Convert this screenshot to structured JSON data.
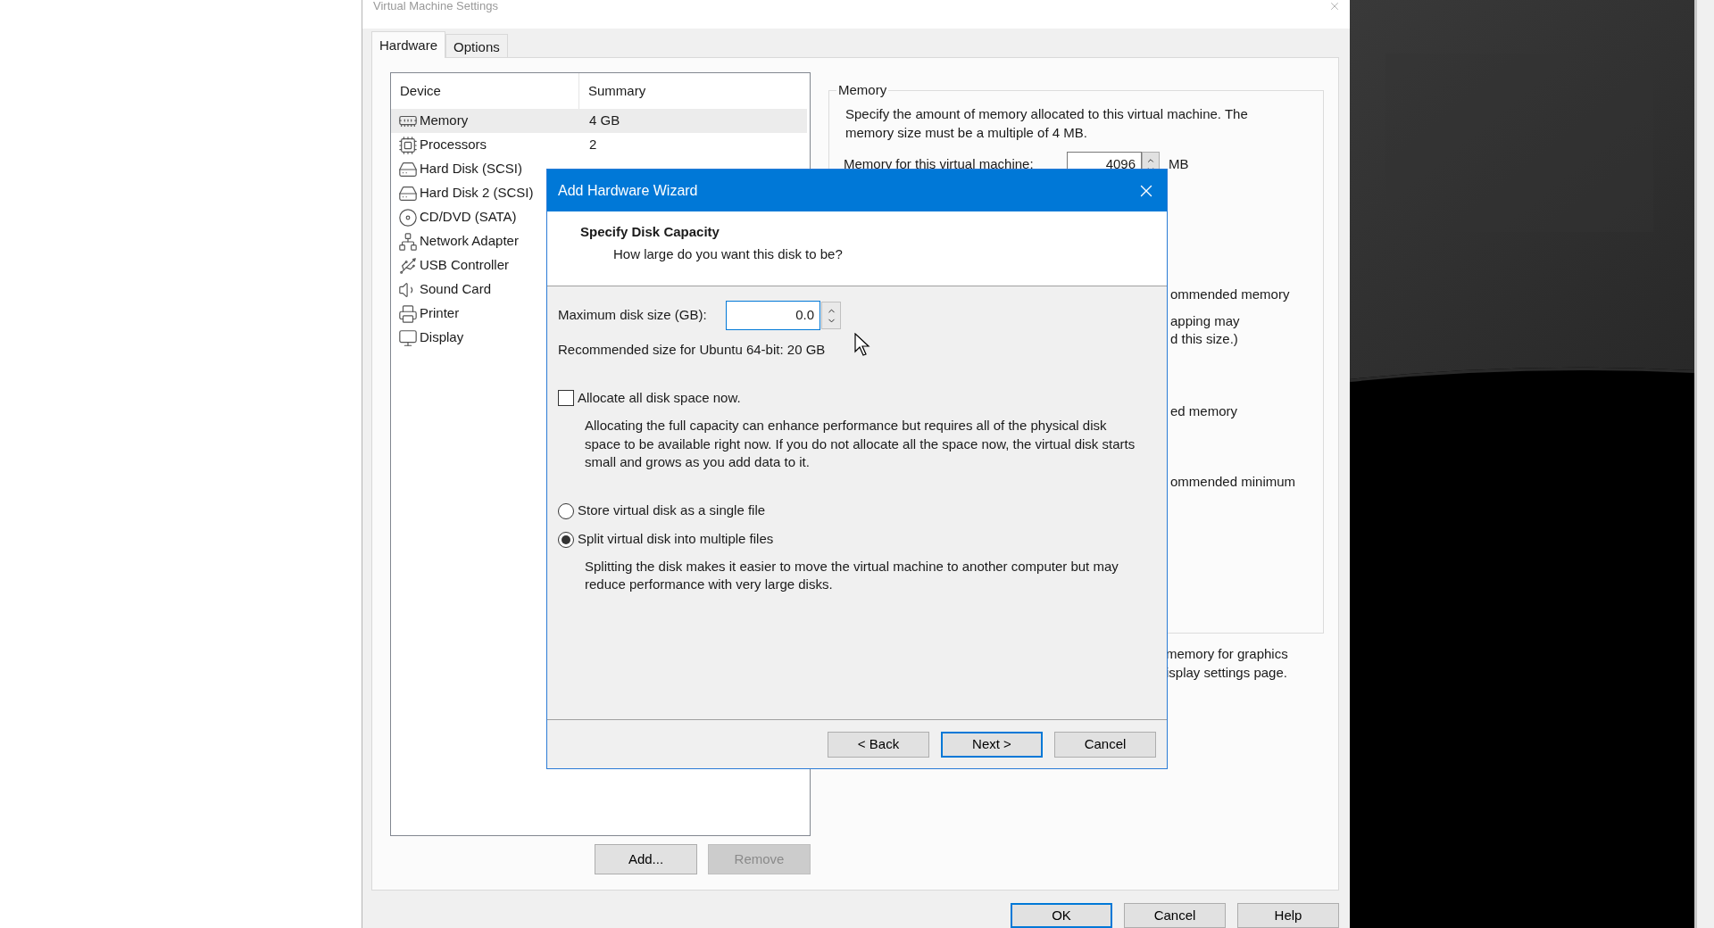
{
  "window": {
    "title": "Virtual Machine Settings"
  },
  "tabs": [
    {
      "label": "Hardware",
      "selected": true
    },
    {
      "label": "Options",
      "selected": false
    }
  ],
  "device_list": {
    "columns": [
      "Device",
      "Summary"
    ],
    "rows": [
      {
        "kind": "memory",
        "device": "Memory",
        "summary": "4 GB",
        "selected": true
      },
      {
        "kind": "processor",
        "device": "Processors",
        "summary": "2",
        "selected": false
      },
      {
        "kind": "disk",
        "device": "Hard Disk (SCSI)",
        "selected": false
      },
      {
        "kind": "disk",
        "device": "Hard Disk 2 (SCSI)",
        "selected": false
      },
      {
        "kind": "cd",
        "device": "CD/DVD (SATA)",
        "selected": false
      },
      {
        "kind": "network",
        "device": "Network Adapter",
        "selected": false
      },
      {
        "kind": "usb",
        "device": "USB Controller",
        "selected": false
      },
      {
        "kind": "sound",
        "device": "Sound Card",
        "selected": false
      },
      {
        "kind": "printer",
        "device": "Printer",
        "selected": false
      },
      {
        "kind": "display",
        "device": "Display",
        "selected": false
      }
    ]
  },
  "list_buttons": [
    {
      "label": "Add...",
      "disabled": false
    },
    {
      "label": "Remove",
      "disabled": true
    }
  ],
  "memory_panel": {
    "title": "Memory",
    "description": "Specify the amount of memory allocated to this virtual machine. The memory size must be a multiple of 4 MB.",
    "memory_label": "Memory for this virtual machine:",
    "memory_value": "4096",
    "unit": "MB",
    "group_fragments": [
      "ommended memory",
      "apping may",
      "d this size.)",
      "ed memory",
      "ommended minimum"
    ],
    "after_fragments": [
      "memory for graphics",
      "isplay settings page."
    ]
  },
  "footer_buttons": [
    {
      "label": "OK",
      "default": true
    },
    {
      "label": "Cancel",
      "default": false
    },
    {
      "label": "Help",
      "default": false
    }
  ],
  "wizard": {
    "title": "Add Hardware Wizard",
    "heading": "Specify Disk Capacity",
    "subheading": "How large do you want this disk to be?",
    "size_label": "Maximum disk size (GB):",
    "size_value": "0.0",
    "recommendation": "Recommended size for Ubuntu 64-bit: 20 GB",
    "allocate": {
      "label": "Allocate all disk space now.",
      "checked": false,
      "description": "Allocating the full capacity can enhance performance but requires all of the physical disk space to be available right now. If you do not allocate all the space now, the virtual disk starts small and grows as you add data to it."
    },
    "storage_options": [
      {
        "label": "Store virtual disk as a single file",
        "selected": false
      },
      {
        "label": "Split virtual disk into multiple files",
        "selected": true,
        "description": "Splitting the disk makes it easier to move the virtual machine to another computer but may reduce performance with very large disks."
      }
    ],
    "buttons": [
      {
        "label": "< Back",
        "default": false
      },
      {
        "label": "Next >",
        "default": true
      },
      {
        "label": "Cancel",
        "default": false
      }
    ]
  }
}
